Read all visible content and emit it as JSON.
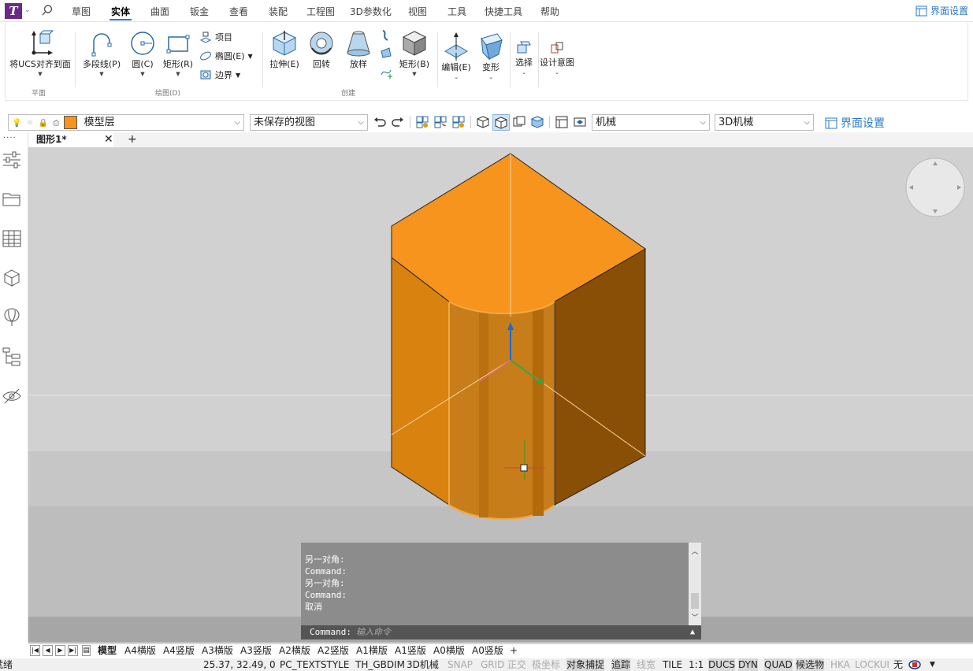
{
  "app": {
    "logo_letter": "T"
  },
  "menu": {
    "tabs": [
      "草图",
      "实体",
      "曲面",
      "钣金",
      "查看",
      "装配",
      "工程图",
      "3D参数化",
      "视图",
      "工具",
      "快捷工具",
      "帮助"
    ],
    "active_tab": "实体",
    "interface_settings": "界面设置"
  },
  "ribbon": {
    "align_ucs": "将UCS对齐到面",
    "polyline": "多段线(P)",
    "circle": "圆(C)",
    "rectangle": "矩形(R)",
    "project": "项目",
    "ellipse": "椭圆(E)",
    "boundary": "边界",
    "extrude": "拉伸(E)",
    "revolve": "回转",
    "loft": "放样",
    "box": "矩形(B)",
    "edit": "编辑(E)",
    "transform": "变形",
    "select": "选择",
    "design_intent": "设计意图",
    "groups": {
      "plane": "平面",
      "draw": "绘图(D)",
      "create": "创建"
    }
  },
  "toolbar": {
    "layer_name": "模型层",
    "layer_color": "#f7941d",
    "view_name": "未保存的视图",
    "workspace": "机械",
    "workspace3d": "3D机械",
    "interface_settings": "界面设置"
  },
  "doc": {
    "tab_name": "图形1*",
    "close": "✕",
    "add": "+"
  },
  "command": {
    "history": [
      "另一对角:",
      "Command:",
      "另一对角:",
      "Command:",
      "取消"
    ],
    "prompt": "Command:",
    "placeholder": "输入命令"
  },
  "layouts": {
    "tabs": [
      "模型",
      "A4横版",
      "A4竖版",
      "A3横版",
      "A3竖版",
      "A2横版",
      "A2竖版",
      "A1横版",
      "A1竖版",
      "A0横版",
      "A0竖版"
    ],
    "add": "+"
  },
  "status": {
    "left": "就绪",
    "coords": "25.37, 32.49, 0",
    "textstyle": "PC_TEXTSTYLE",
    "dimstyle": "TH_GBDIM",
    "workspace": "3D机械",
    "toggles": [
      {
        "label": "SNAP",
        "state": "off"
      },
      {
        "label": "GRID",
        "state": "off"
      },
      {
        "label": "正交",
        "state": "off"
      },
      {
        "label": "极坐标",
        "state": "off"
      },
      {
        "label": "对象捕捉",
        "state": "on"
      },
      {
        "label": "追踪",
        "state": "on"
      },
      {
        "label": "线宽",
        "state": "off"
      },
      {
        "label": "TILE",
        "state": "normal"
      },
      {
        "label": "1:1",
        "state": "normal"
      },
      {
        "label": "DUCS",
        "state": "on"
      },
      {
        "label": "DYN",
        "state": "on"
      },
      {
        "label": "QUAD",
        "state": "on"
      },
      {
        "label": "候选物",
        "state": "on"
      },
      {
        "label": "HKA",
        "state": "off"
      },
      {
        "label": "LOCKUI",
        "state": "off"
      },
      {
        "label": "无",
        "state": "normal"
      }
    ]
  },
  "colors": {
    "solid_top": "#f7941d",
    "solid_left": "#d9820f",
    "solid_right": "#8a4f07",
    "accent": "#2a7ac8"
  }
}
